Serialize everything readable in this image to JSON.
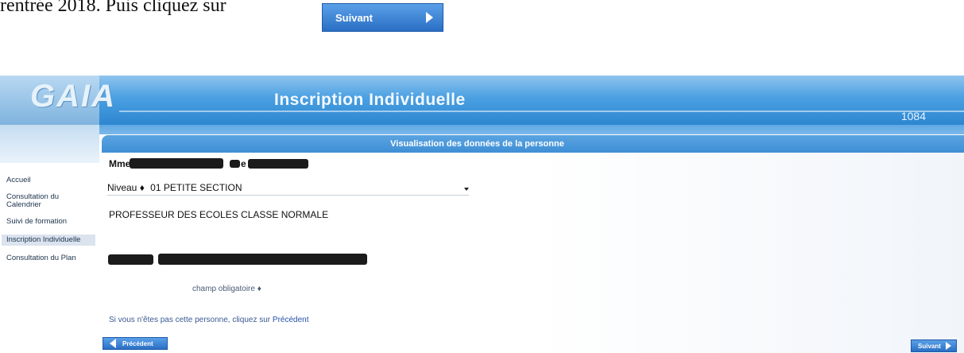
{
  "instruction": {
    "text": "rentrée 2018. Puis cliquez sur"
  },
  "top_next_button": {
    "label": "Suivant"
  },
  "app": {
    "logo": "GAIA",
    "title": "Inscription Individuelle",
    "code": "1084"
  },
  "sidebar": {
    "items": [
      {
        "label": "Accueil"
      },
      {
        "label": "Consultation du Calendrier"
      },
      {
        "label": "Suivi de formation"
      },
      {
        "label": "Inscription Individuelle"
      },
      {
        "label": "Consultation du Plan"
      }
    ]
  },
  "panel": {
    "header": "Visualisation des données de la personne",
    "salutation": "Mme",
    "name_suffix": "e",
    "niveau_label": "Niveau ♦",
    "niveau_value": "01 PETITE SECTION",
    "grade": "PROFESSEUR DES ECOLES CLASSE NORMALE",
    "required_note": "champ obligatoire ♦",
    "hint_prefix": "Si vous n'êtes pas cette personne, cliquez sur",
    "hint_link": "Précédent",
    "prev_button": "Précédent",
    "next_button": "Suivant"
  }
}
